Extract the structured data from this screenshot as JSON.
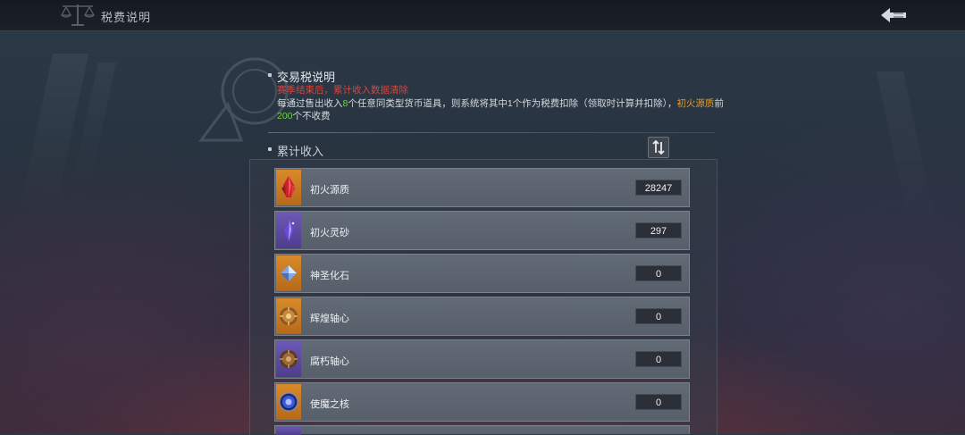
{
  "header": {
    "title": "税费说明",
    "emblem_icon": "scales-icon",
    "back_icon": "back-arrow-icon"
  },
  "info": {
    "title": "交易税说明",
    "warning": "赛季结束后，累计收入数据清除",
    "desc_p1": "每通过售出收入",
    "desc_count": "8",
    "desc_p2": "个任意同类型货币道具，则系统将其中1个作为税费扣除（领取时计算并扣除），",
    "desc_item": "初火源质",
    "desc_p3": "前",
    "desc_limit": "200",
    "desc_p4": "个不收费"
  },
  "income": {
    "title": "累计收入",
    "sort_icon": "sort-icon",
    "items": [
      {
        "name": "初火源质",
        "value": "28247",
        "icon": "red-crystal-icon",
        "frame": "gold"
      },
      {
        "name": "初火灵砂",
        "value": "297",
        "icon": "purple-shard-icon",
        "frame": "purple"
      },
      {
        "name": "神圣化石",
        "value": "0",
        "icon": "blue-gem-icon",
        "frame": "gold"
      },
      {
        "name": "辉煌轴心",
        "value": "0",
        "icon": "gold-core-icon",
        "frame": "gold"
      },
      {
        "name": "腐朽轴心",
        "value": "0",
        "icon": "bronze-core-icon",
        "frame": "purple"
      },
      {
        "name": "使魔之核",
        "value": "0",
        "icon": "blue-orb-icon",
        "frame": "gold"
      }
    ]
  },
  "colors": {
    "warning": "#d9443c",
    "highlight_green": "#6fd04a",
    "highlight_orange": "#e39b2a",
    "frame_gold": "#d88a2a",
    "frame_purple": "#6c58b6"
  }
}
